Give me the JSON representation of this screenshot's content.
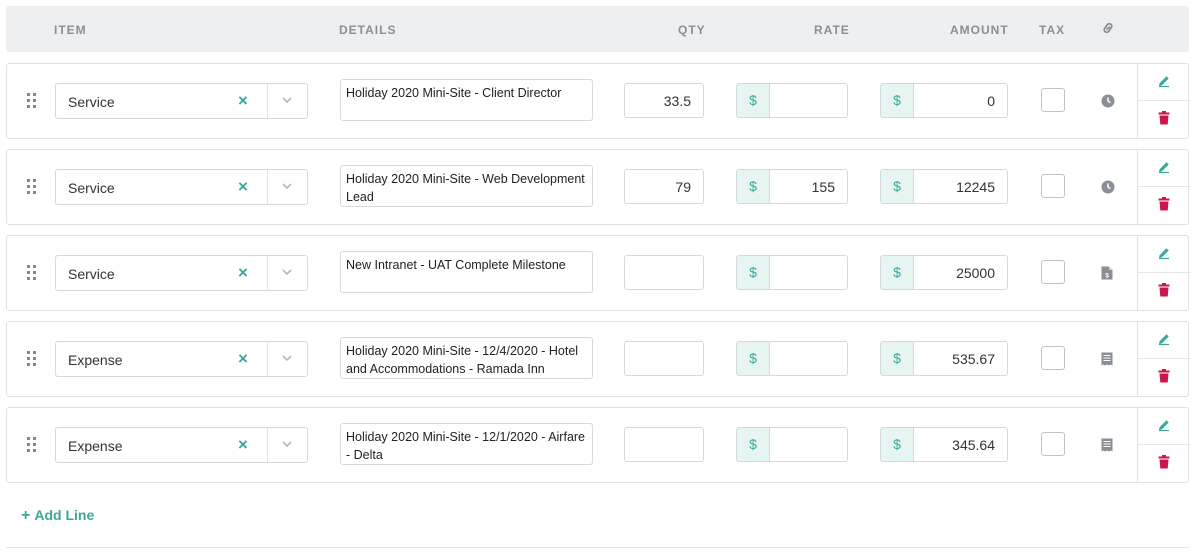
{
  "columns": {
    "item": "ITEM",
    "details": "DETAILS",
    "qty": "QTY",
    "rate": "RATE",
    "amount": "AMOUNT",
    "tax": "TAX",
    "link_icon": "link-icon"
  },
  "currency_symbol": "$",
  "lines": [
    {
      "item": "Service",
      "details": "Holiday 2020 Mini-Site - Client Director",
      "qty": "33.5",
      "rate": "",
      "amount": "0",
      "tax_checked": false,
      "type_icon": "clock-icon"
    },
    {
      "item": "Service",
      "details": "Holiday 2020 Mini-Site - Web Development Lead",
      "qty": "79",
      "rate": "155",
      "amount": "12245",
      "tax_checked": false,
      "type_icon": "clock-icon"
    },
    {
      "item": "Service",
      "details": "New Intranet - UAT Complete Milestone",
      "qty": "",
      "rate": "",
      "amount": "25000",
      "tax_checked": false,
      "type_icon": "document-icon"
    },
    {
      "item": "Expense",
      "details": "Holiday 2020 Mini-Site - 12/4/2020 - Hotel and Accommodations - Ramada Inn",
      "qty": "",
      "rate": "",
      "amount": "535.67",
      "tax_checked": false,
      "type_icon": "receipt-icon"
    },
    {
      "item": "Expense",
      "details": "Holiday 2020 Mini-Site - 12/1/2020 - Airfare - Delta",
      "qty": "",
      "rate": "",
      "amount": "345.64",
      "tax_checked": false,
      "type_icon": "receipt-icon"
    }
  ],
  "add_line_label": "Add Line",
  "colors": {
    "accent": "#3aa79a",
    "delete": "#c8174d",
    "header_bg": "#eeeff1",
    "currency_bg": "#e6f4f2"
  }
}
